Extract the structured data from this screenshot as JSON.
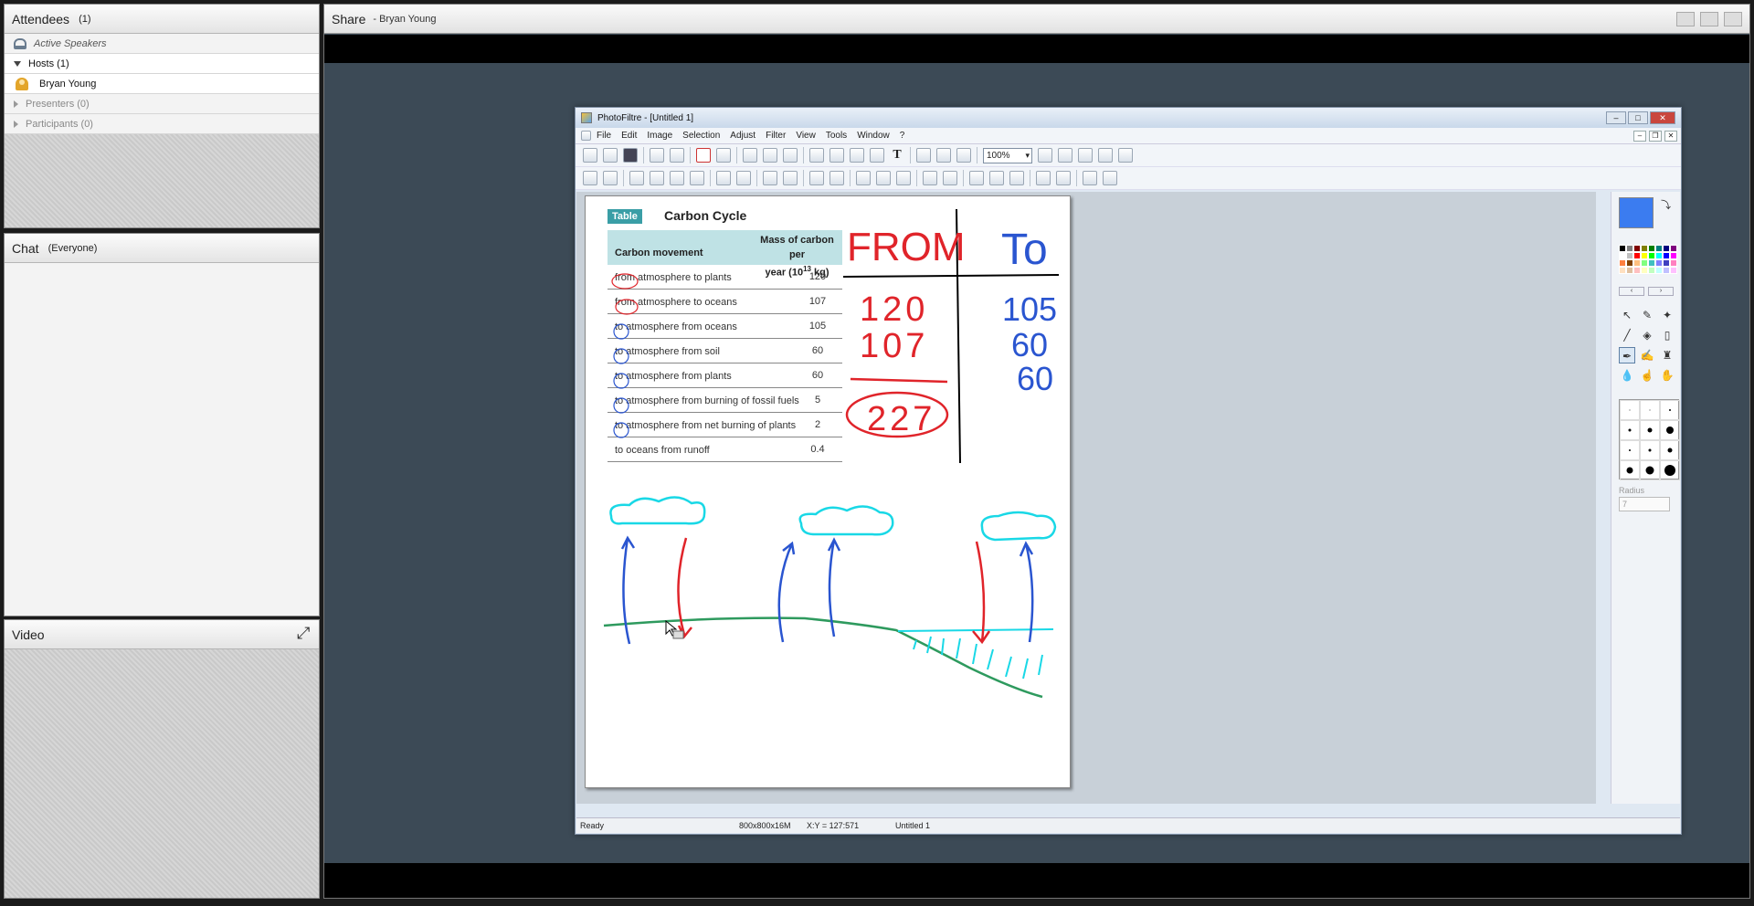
{
  "attendees": {
    "title": "Attendees",
    "count": "(1)",
    "active_speakers": "Active Speakers",
    "hosts_label": "Hosts (1)",
    "host_user": "Bryan Young",
    "presenters_label": "Presenters (0)",
    "participants_label": "Participants (0)"
  },
  "chat": {
    "title": "Chat",
    "scope": "(Everyone)"
  },
  "video": {
    "title": "Video"
  },
  "share": {
    "title": "Share",
    "presenter": "- Bryan Young"
  },
  "photofiltre": {
    "window_title": "PhotoFiltre - [Untitled 1]",
    "menu": [
      "File",
      "Edit",
      "Image",
      "Selection",
      "Adjust",
      "Filter",
      "View",
      "Tools",
      "Window",
      "?"
    ],
    "zoom": "100%",
    "status": {
      "state": "Ready",
      "size": "800x800x16M",
      "coords": "X:Y = 127:571",
      "doc": "Untitled 1"
    },
    "radius_label": "Radius",
    "radius_value": "7",
    "fg_color": "#3b7cf0"
  },
  "canvas": {
    "table_tag": "Table",
    "table_title": "Carbon Cycle",
    "col1_header": "Carbon movement",
    "col2_header_line1": "Mass of carbon per",
    "col2_header_line2": "year (10",
    "col2_header_sup": "13",
    "col2_header_unit": " kg)",
    "rows": [
      {
        "label": "from atmosphere to plants",
        "value": "120"
      },
      {
        "label": "from atmosphere to oceans",
        "value": "107"
      },
      {
        "label": "to atmosphere from oceans",
        "value": "105"
      },
      {
        "label": "to atmosphere from soil",
        "value": "60"
      },
      {
        "label": "to atmosphere from plants",
        "value": "60"
      },
      {
        "label": "to atmosphere from burning of fossil fuels",
        "value": "5"
      },
      {
        "label": "to atmosphere from net burning of plants",
        "value": "2"
      },
      {
        "label": "to oceans from runoff",
        "value": "0.4"
      }
    ],
    "handwriting": {
      "from_heading": "FROM",
      "to_heading": "To",
      "from_values": [
        "120",
        "107"
      ],
      "from_total": "227",
      "to_values": [
        "105",
        "60",
        "60"
      ]
    }
  }
}
